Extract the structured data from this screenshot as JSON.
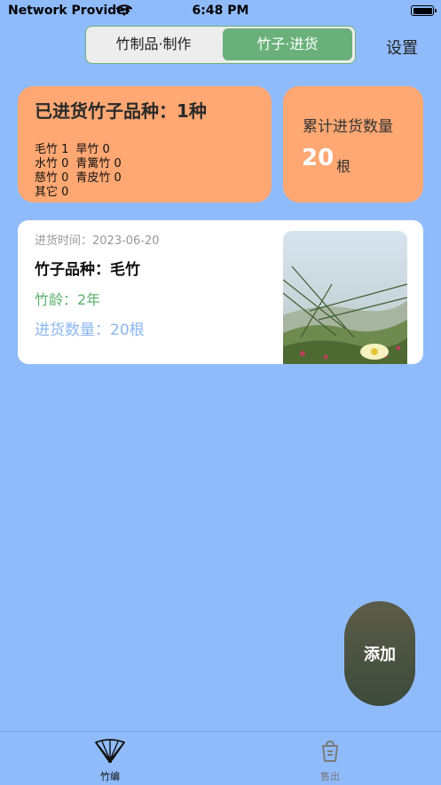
{
  "status_bar": {
    "carrier": "Network Provider",
    "time": "6:48 PM"
  },
  "header": {
    "segments": [
      "竹制品·制作",
      "竹子·进货"
    ],
    "active_segment": "竹子·进货",
    "settings": "设置"
  },
  "summary": {
    "title": "已进货竹子品种：1种",
    "stats": [
      [
        {
          "text": "毛竹 1"
        },
        {
          "text": "旱竹 0"
        }
      ],
      [
        {
          "text": "水竹 0"
        },
        {
          "text": "青篱竹 0"
        }
      ],
      [
        {
          "text": "慈竹 0"
        },
        {
          "text": "青皮竹 0"
        }
      ],
      [
        {
          "text": "其它 0"
        }
      ]
    ]
  },
  "total": {
    "label": "累计进货数量",
    "value": "20",
    "unit": "根"
  },
  "records": [
    {
      "date": "进货时间：2023-06-20",
      "variety": "竹子品种：毛竹",
      "age": "竹龄：2年",
      "quantity": "进货数量：20根"
    }
  ],
  "add_button": "添加",
  "tabbar": {
    "tabs": [
      "竹编",
      "售出"
    ],
    "active": "竹编"
  },
  "colors": {
    "background": "#90bbfb",
    "card_orange": "#ffa873",
    "segment_active": "#69b07a",
    "age_green": "#5bb06d",
    "qty_blue": "#8bb7f2"
  }
}
